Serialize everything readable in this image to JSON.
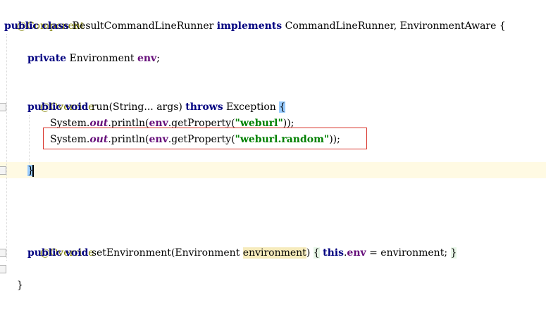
{
  "editor": {
    "lines": {
      "annotation_component": "@Component",
      "class_decl": {
        "kw_public": "public",
        "kw_class": "class",
        "class_name": " ResultCommandLineRunner ",
        "kw_implements": "implements",
        "interfaces": " CommandLineRunner, EnvironmentAware {"
      },
      "field_decl": {
        "kw_private": "private",
        "type": " Environment ",
        "name": "env",
        "semicolon": ";"
      },
      "override1": "@Override",
      "run_decl": {
        "kw_public": "public",
        "kw_void": " void",
        "signature": " run(String... args) ",
        "kw_throws": "throws",
        "exception": " Exception ",
        "open_brace": "{"
      },
      "println1": {
        "prefix": "System.",
        "out": "out",
        "mid": ".println(",
        "env": "env",
        "get": ".getProperty(",
        "string": "\"weburl\"",
        "suffix": "));"
      },
      "println2": {
        "prefix": "System.",
        "out": "out",
        "mid": ".println(",
        "env": "env",
        "get": ".getProperty(",
        "string": "\"weburl.random\"",
        "suffix": "));"
      },
      "close_brace": "}",
      "override2": "@Override",
      "setenv_decl": {
        "kw_public": "public",
        "kw_void": " void",
        "method": " setEnvironment(Environment ",
        "param": "environment",
        "close_paren": ")",
        "open_brace": "{",
        "kw_this": "this",
        "dot": ".",
        "field": "env",
        "assign": " = environment;",
        "close_brace": "}"
      },
      "class_close": "}"
    }
  },
  "colors": {
    "keyword": "#000080",
    "annotation": "#808000",
    "field": "#660e7a",
    "string": "#008000",
    "callout_border": "#d9342b",
    "caret_line": "#fffae3"
  }
}
